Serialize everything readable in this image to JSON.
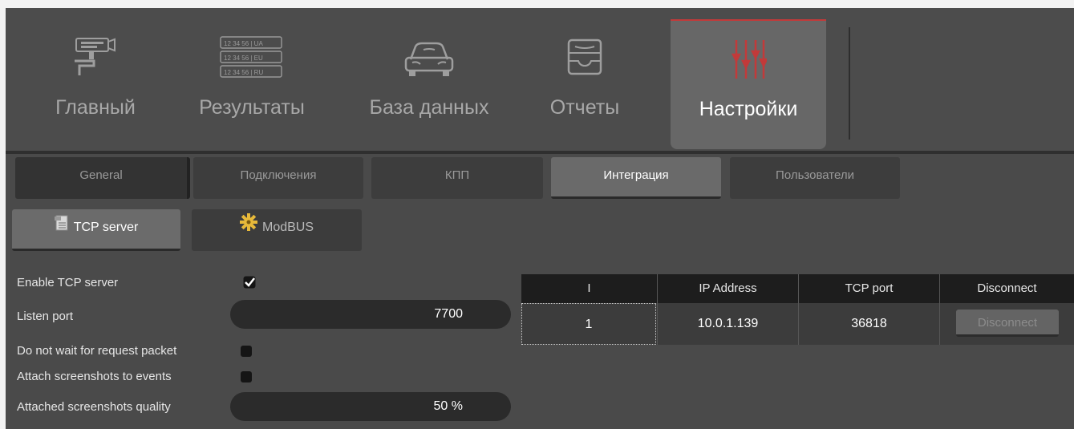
{
  "top_nav": {
    "items": [
      {
        "label": "Главный"
      },
      {
        "label": "Результаты",
        "plates": [
          "12 34 56 | UA",
          "12 34 56 | EU",
          "12 34 56 | RU"
        ]
      },
      {
        "label": "База данных"
      },
      {
        "label": "Отчеты"
      },
      {
        "label": "Настройки"
      }
    ]
  },
  "settings_tabs": [
    "General",
    "Подключения",
    "КПП",
    "Интеграция",
    "Пользователи"
  ],
  "integration_tabs": [
    "TCP server",
    "ModBUS"
  ],
  "tcp": {
    "enable_label": "Enable TCP server",
    "listen_port_label": "Listen port",
    "listen_port_value": "7700",
    "no_wait_label": "Do not wait for request packet",
    "attach_label": "Attach screenshots to events",
    "quality_label": "Attached screenshots quality",
    "quality_value": "50 %"
  },
  "clients_table": {
    "headers": [
      "I",
      "IP Address",
      "TCP port",
      "Disconnect"
    ],
    "rows": [
      {
        "index": "1",
        "ip": "10.0.1.139",
        "port": "36818",
        "action": "Disconnect"
      }
    ]
  },
  "colors": {
    "accent": "#c23a3a",
    "background": "#4a4a4a"
  },
  "icons": [
    "camera-icon",
    "license-plates-icon",
    "car-icon",
    "inbox-tray-icon",
    "sliders-icon",
    "document-icon",
    "gear-icon",
    "checkmark-icon"
  ]
}
